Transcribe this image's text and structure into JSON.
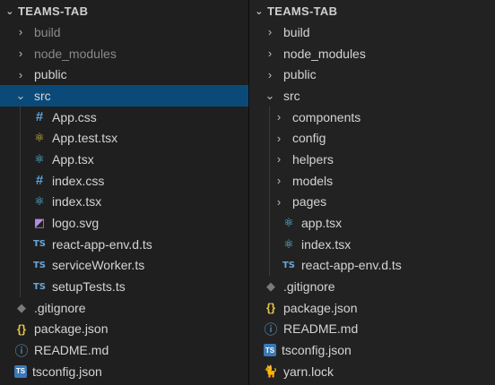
{
  "left": {
    "title": "TEAMS-TAB",
    "items": [
      {
        "label": "build",
        "kind": "folder",
        "depth": 1,
        "expanded": false,
        "dim": true
      },
      {
        "label": "node_modules",
        "kind": "folder",
        "depth": 1,
        "expanded": false,
        "dim": true
      },
      {
        "label": "public",
        "kind": "folder",
        "depth": 1,
        "expanded": false,
        "dim": false
      },
      {
        "label": "src",
        "kind": "folder",
        "depth": 1,
        "expanded": true,
        "dim": false,
        "selected": true
      },
      {
        "label": "App.css",
        "kind": "file",
        "icon": "hash-icon",
        "depth": 2
      },
      {
        "label": "App.test.tsx",
        "kind": "file",
        "icon": "react-test-icon",
        "depth": 2
      },
      {
        "label": "App.tsx",
        "kind": "file",
        "icon": "react-icon",
        "depth": 2
      },
      {
        "label": "index.css",
        "kind": "file",
        "icon": "hash-icon",
        "depth": 2
      },
      {
        "label": "index.tsx",
        "kind": "file",
        "icon": "react-icon",
        "depth": 2
      },
      {
        "label": "logo.svg",
        "kind": "file",
        "icon": "svg-icon",
        "depth": 2
      },
      {
        "label": "react-app-env.d.ts",
        "kind": "file",
        "icon": "typescript-icon",
        "depth": 2
      },
      {
        "label": "serviceWorker.ts",
        "kind": "file",
        "icon": "typescript-icon",
        "depth": 2
      },
      {
        "label": "setupTests.ts",
        "kind": "file",
        "icon": "typescript-icon",
        "depth": 2
      },
      {
        "label": ".gitignore",
        "kind": "file",
        "icon": "git-icon",
        "depth": 1
      },
      {
        "label": "package.json",
        "kind": "file",
        "icon": "json-icon",
        "depth": 1
      },
      {
        "label": "README.md",
        "kind": "file",
        "icon": "info-icon",
        "depth": 1
      },
      {
        "label": "tsconfig.json",
        "kind": "file",
        "icon": "tsconfig-icon",
        "depth": 1
      }
    ]
  },
  "right": {
    "title": "TEAMS-TAB",
    "items": [
      {
        "label": "build",
        "kind": "folder",
        "depth": 1,
        "expanded": false
      },
      {
        "label": "node_modules",
        "kind": "folder",
        "depth": 1,
        "expanded": false
      },
      {
        "label": "public",
        "kind": "folder",
        "depth": 1,
        "expanded": false
      },
      {
        "label": "src",
        "kind": "folder",
        "depth": 1,
        "expanded": true
      },
      {
        "label": "components",
        "kind": "folder",
        "depth": 2,
        "expanded": false
      },
      {
        "label": "config",
        "kind": "folder",
        "depth": 2,
        "expanded": false
      },
      {
        "label": "helpers",
        "kind": "folder",
        "depth": 2,
        "expanded": false
      },
      {
        "label": "models",
        "kind": "folder",
        "depth": 2,
        "expanded": false
      },
      {
        "label": "pages",
        "kind": "folder",
        "depth": 2,
        "expanded": false
      },
      {
        "label": "app.tsx",
        "kind": "file",
        "icon": "react-icon",
        "depth": 2
      },
      {
        "label": "index.tsx",
        "kind": "file",
        "icon": "react-icon",
        "depth": 2
      },
      {
        "label": "react-app-env.d.ts",
        "kind": "file",
        "icon": "typescript-icon",
        "depth": 2
      },
      {
        "label": ".gitignore",
        "kind": "file",
        "icon": "git-icon",
        "depth": 1
      },
      {
        "label": "package.json",
        "kind": "file",
        "icon": "json-icon",
        "depth": 1
      },
      {
        "label": "README.md",
        "kind": "file",
        "icon": "info-icon",
        "depth": 1
      },
      {
        "label": "tsconfig.json",
        "kind": "file",
        "icon": "tsconfig-icon",
        "depth": 1
      },
      {
        "label": "yarn.lock",
        "kind": "file",
        "icon": "yarn-icon",
        "depth": 1
      }
    ]
  },
  "colors": {
    "selection": "#0b4a78",
    "background": "#1e1e1e"
  }
}
